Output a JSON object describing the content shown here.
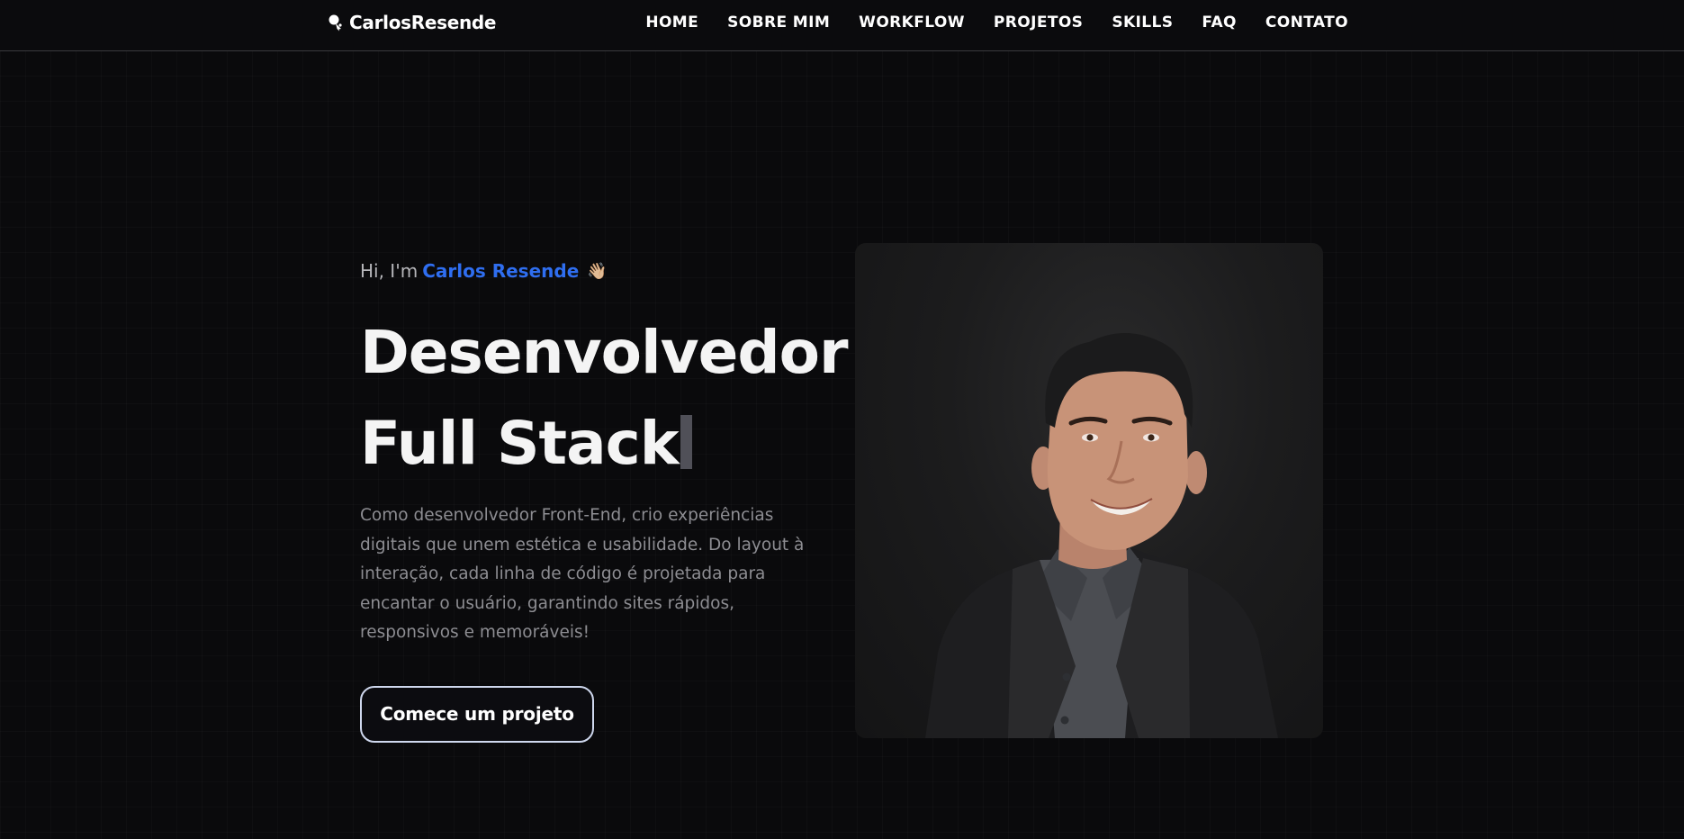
{
  "brand": {
    "name": "CarlosResende",
    "icon": "rocket-icon"
  },
  "nav": {
    "items": [
      {
        "label": "HOME"
      },
      {
        "label": "SOBRE MIM"
      },
      {
        "label": "WORKFLOW"
      },
      {
        "label": "PROJETOS"
      },
      {
        "label": "SKILLS"
      },
      {
        "label": "FAQ"
      },
      {
        "label": "CONTATO"
      }
    ]
  },
  "hero": {
    "greeting_prefix": "Hi, I'm",
    "greeting_name": "Carlos Resende",
    "wave_emoji": "👋🏼",
    "title_line1": "Desenvolvedor",
    "title_line2": "Full Stack",
    "description": "Como desenvolvedor Front-End, crio experiências digitais que unem estética e usabilidade. Do layout à interação, cada linha de código é projetada para encantar o usuário, garantindo sites rápidos, responsivos e memoráveis!",
    "cta_label": "Comece um projeto",
    "photo_alt": "Foto de perfil"
  },
  "colors": {
    "accent": "#2f6ef0",
    "background": "#0a0a0c"
  }
}
